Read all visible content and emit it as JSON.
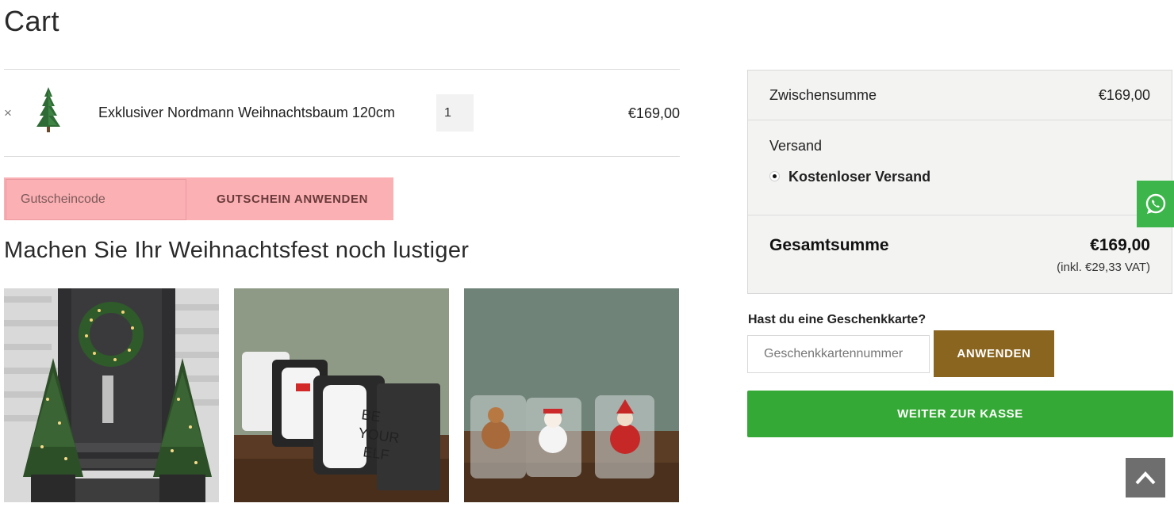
{
  "page": {
    "title": "Cart"
  },
  "cart": {
    "remove_symbol": "×",
    "item": {
      "name": "Exklusiver Nordmann Weihnachtsbaum 120cm",
      "quantity": "1",
      "price": "€169,00"
    }
  },
  "coupon": {
    "placeholder": "Gutscheincode",
    "button_label": "GUTSCHEIN ANWENDEN"
  },
  "upsell": {
    "title": "Machen Sie Ihr Weihnachtsfest noch lustiger"
  },
  "summary": {
    "subtotal_label": "Zwischensumme",
    "subtotal_value": "€169,00",
    "shipping_label": "Versand",
    "shipping_option": "Kostenloser Versand",
    "total_label": "Gesamtsumme",
    "total_value": "€169,00",
    "vat_note": "(inkl. €29,33 VAT)"
  },
  "giftcard": {
    "question": "Hast du eine Geschenkkarte?",
    "placeholder": "Geschenkkartennummer",
    "button_label": "ANWENDEN"
  },
  "checkout": {
    "button_label": "WEITER ZUR KASSE"
  },
  "colors": {
    "coupon_bg": "#fbb0b4",
    "giftcard_button": "#8a6520",
    "checkout_button": "#35a935",
    "whatsapp": "#3cb64a",
    "scroll_top": "#6e6e6e"
  },
  "icons": [
    "whatsapp-icon",
    "chevron-up-icon"
  ]
}
